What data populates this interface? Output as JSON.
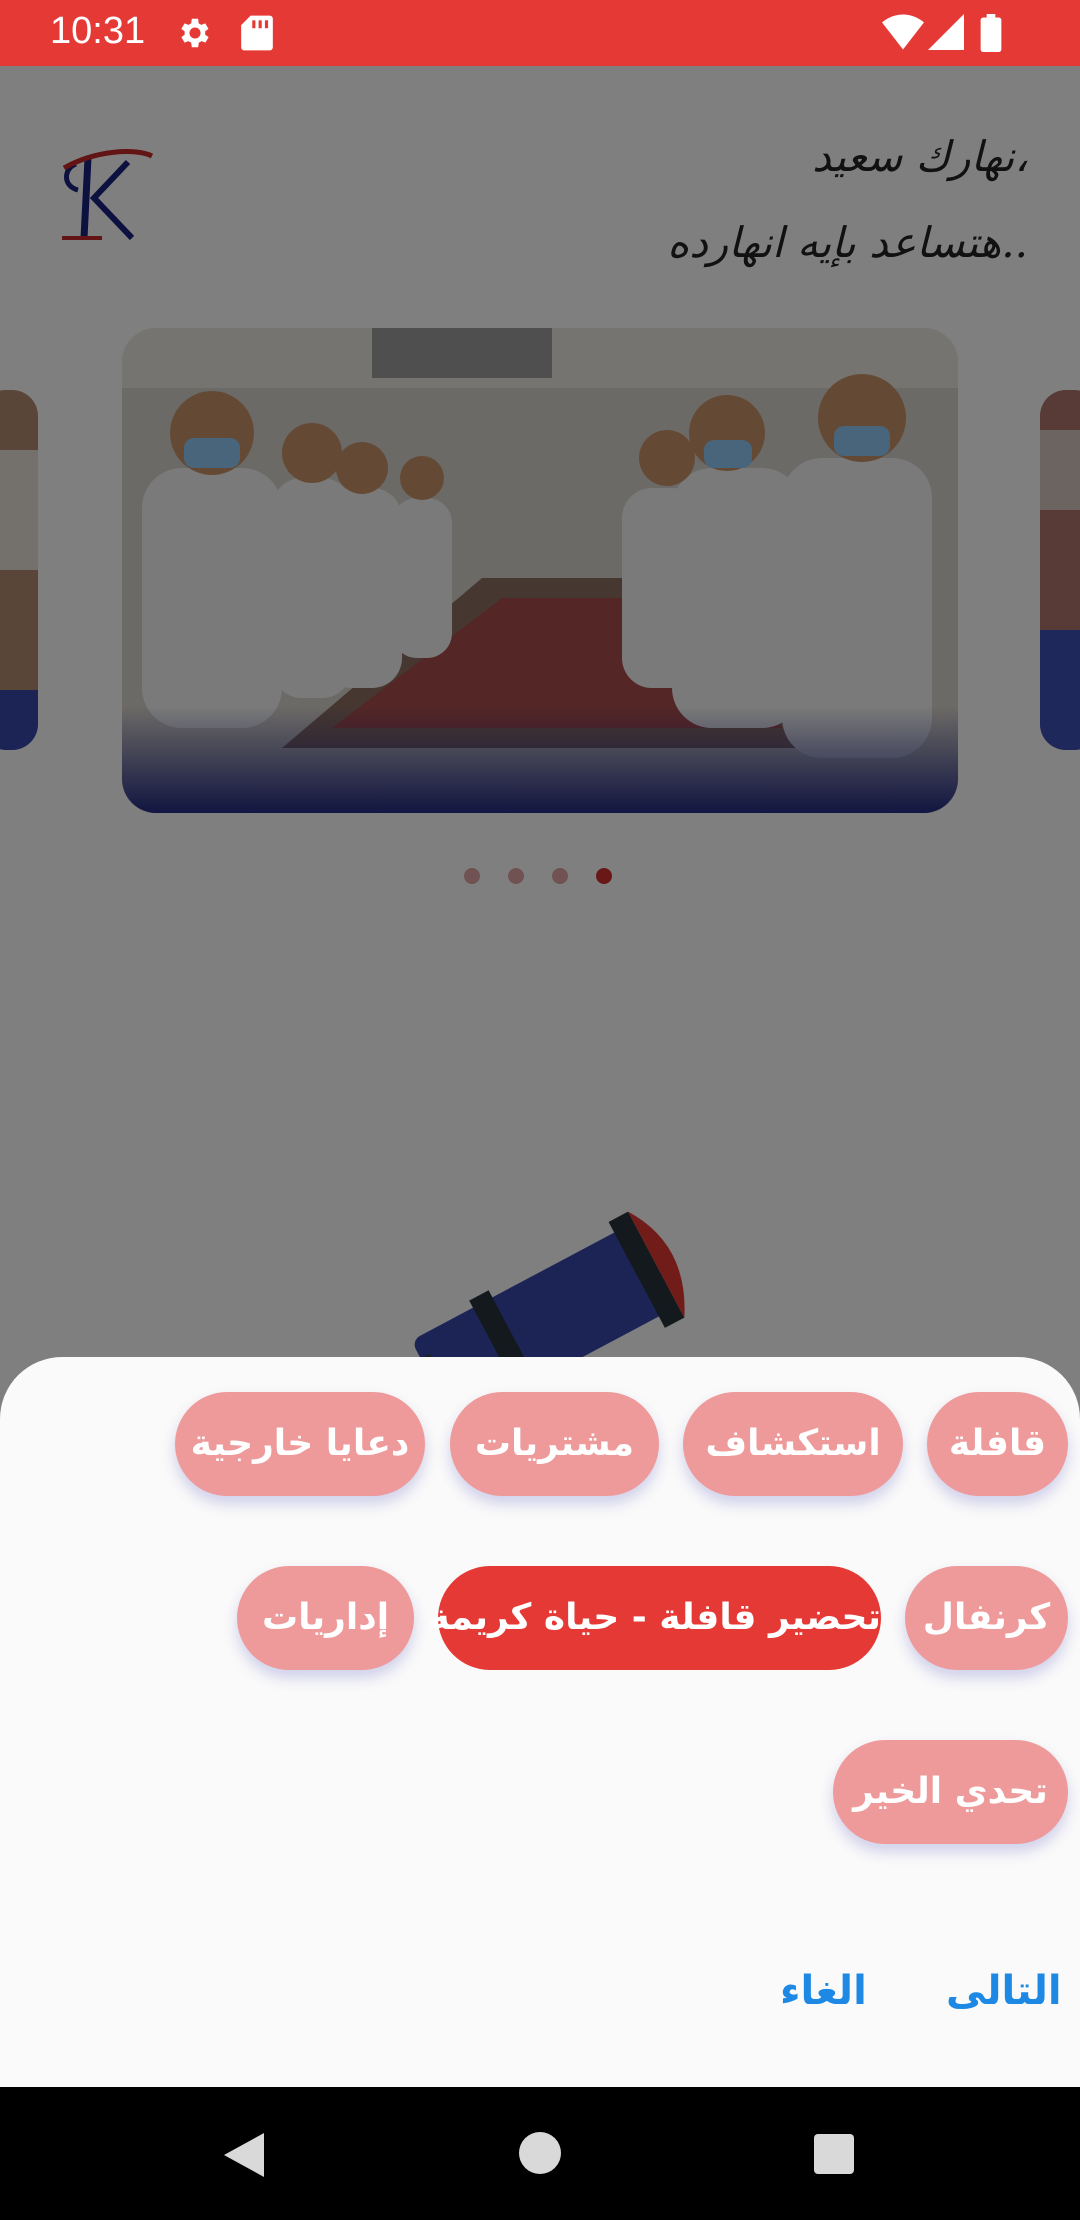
{
  "status_bar": {
    "time": "10:31",
    "left_icons": [
      "gear-icon",
      "sd-card-icon"
    ],
    "right_icons": [
      "wifi-icon",
      "signal-icon",
      "battery-icon"
    ],
    "color": "#e53935"
  },
  "header": {
    "greeting_line1": "نهارك سعيد،",
    "greeting_line2": "هتساعد بإيه انهارده.."
  },
  "carousel": {
    "page_count": 4,
    "active_index": 3
  },
  "categories": {
    "chips": [
      {
        "label": "قافلة",
        "selected": false
      },
      {
        "label": "استكشاف",
        "selected": false
      },
      {
        "label": "مشتريات",
        "selected": false
      },
      {
        "label": "دعايا خارجية",
        "selected": false
      },
      {
        "label": "كرنفال",
        "selected": false
      },
      {
        "label": "تحضير قافلة - حياة كريمة",
        "selected": true
      },
      {
        "label": "إداريات",
        "selected": false
      },
      {
        "label": "تحدي الخير",
        "selected": false
      }
    ],
    "colors": {
      "chip": "#ef9a9a",
      "selected": "#e53935"
    }
  },
  "actions": {
    "next_label": "التالى",
    "cancel_label": "الغاء",
    "color": "#1e88e5"
  },
  "nav_bar": {
    "icons": [
      "back-icon",
      "home-icon",
      "recents-icon"
    ]
  }
}
